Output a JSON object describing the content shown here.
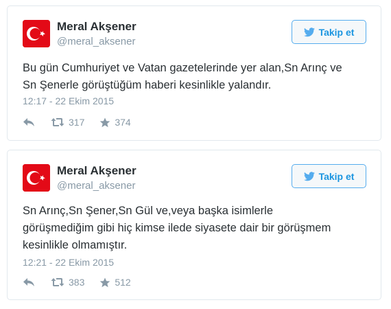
{
  "tweets": [
    {
      "author": {
        "name": "Meral Akşener",
        "handle": "@meral_aksener",
        "avatar_icon": "turkish-flag-icon"
      },
      "follow_label": "Takip et",
      "text": "Bu gün Cumhuriyet ve Vatan gazetelerinde yer alan,Sn Arınç ve\nSn Şenerle görüştüğüm haberi kesinlikle yalandır.",
      "timestamp": "12:17 - 22 Ekim 2015",
      "retweets": "317",
      "favorites": "374"
    },
    {
      "author": {
        "name": "Meral Akşener",
        "handle": "@meral_aksener",
        "avatar_icon": "turkish-flag-icon"
      },
      "follow_label": "Takip et",
      "text": "Sn Arınç,Sn Şener,Sn Gül ve,veya başka isimlerle\ngörüşmediğim gibi hiç kimse ilede siyasete dair bir görüşmem\nkesinlikle olmamıştır.",
      "timestamp": "12:21 - 22 Ekim 2015",
      "retweets": "383",
      "favorites": "512"
    }
  ],
  "colors": {
    "accent": "#55acee",
    "flag_red": "#e30a17",
    "muted": "#8899a6",
    "text": "#292f33"
  },
  "icons": {
    "follow": "twitter-bird-icon",
    "reply": "reply-icon",
    "retweet": "retweet-icon",
    "favorite": "star-icon"
  }
}
